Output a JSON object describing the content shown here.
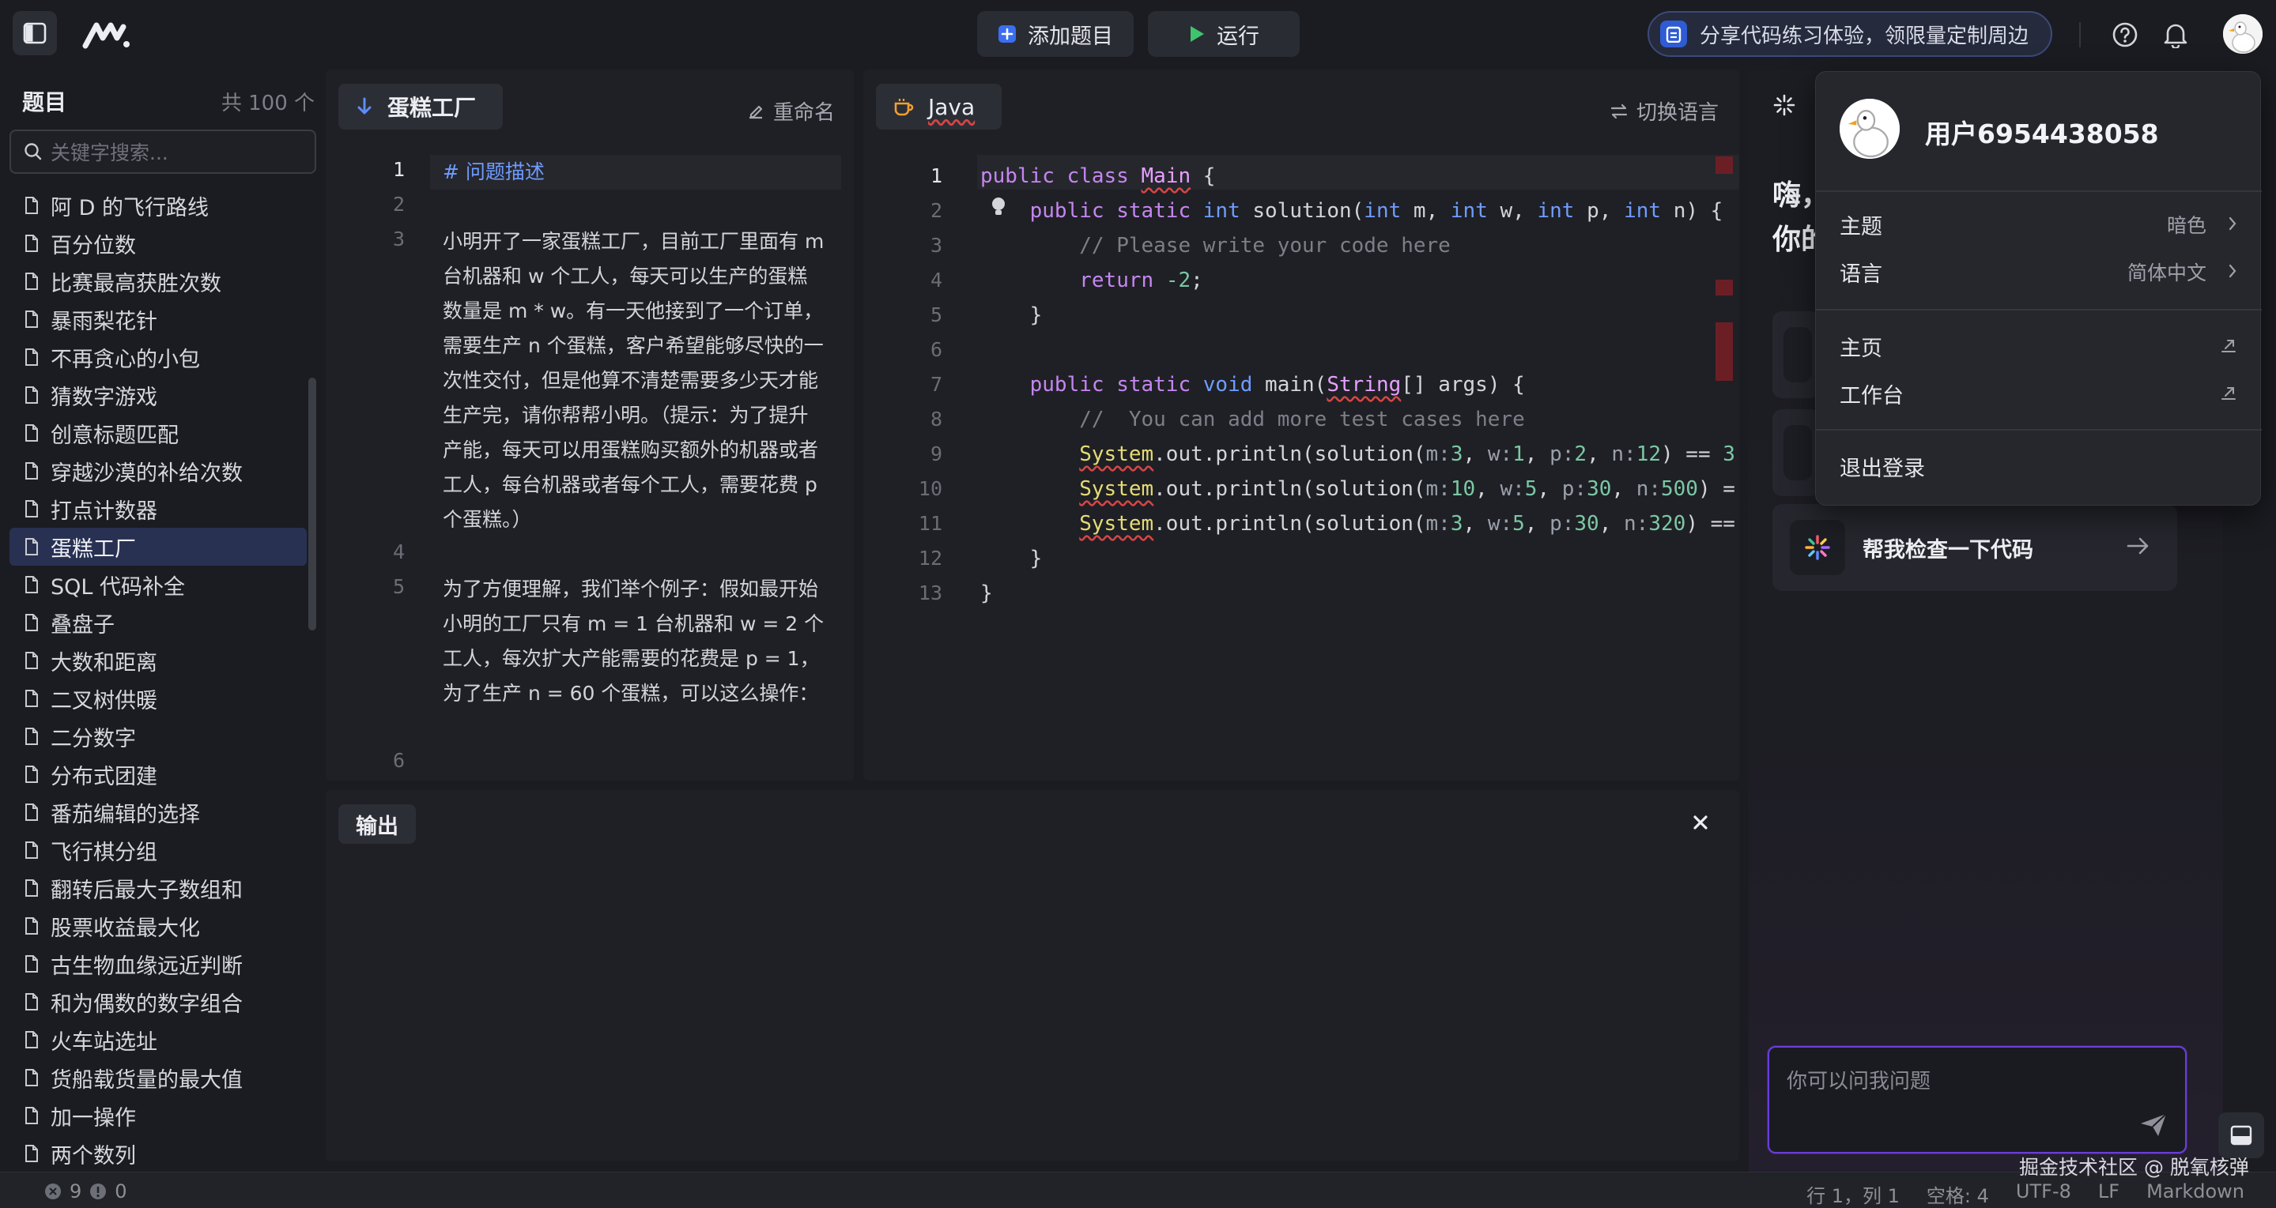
{
  "toolbar": {
    "add_question": "添加题目",
    "run": "运行",
    "promo": "分享代码练习体验，领限量定制周边"
  },
  "sidebar": {
    "title": "题目",
    "count": "共 100 个",
    "search_placeholder": "关键字搜索...",
    "items": [
      {
        "label": "阿 D 的飞行路线"
      },
      {
        "label": "百分位数"
      },
      {
        "label": "比赛最高获胜次数"
      },
      {
        "label": "暴雨梨花针"
      },
      {
        "label": "不再贪心的小包"
      },
      {
        "label": "猜数字游戏"
      },
      {
        "label": "创意标题匹配"
      },
      {
        "label": "穿越沙漠的补给次数"
      },
      {
        "label": "打点计数器"
      },
      {
        "label": "蛋糕工厂"
      },
      {
        "label": "SQL 代码补全"
      },
      {
        "label": "叠盘子"
      },
      {
        "label": "大数和距离"
      },
      {
        "label": "二叉树供暖"
      },
      {
        "label": "二分数字"
      },
      {
        "label": "分布式团建"
      },
      {
        "label": "番茄编辑的选择"
      },
      {
        "label": "飞行棋分组"
      },
      {
        "label": "翻转后最大子数组和"
      },
      {
        "label": "股票收益最大化"
      },
      {
        "label": "古生物血缘远近判断"
      },
      {
        "label": "和为偶数的数字组合"
      },
      {
        "label": "火车站选址"
      },
      {
        "label": "货船载货量的最大值"
      },
      {
        "label": "加一操作"
      },
      {
        "label": "两个数列"
      }
    ],
    "active_index": 9
  },
  "problem": {
    "tab": "蛋糕工厂",
    "rename": "重命名",
    "line_numbers": [
      "1",
      "2",
      "3",
      "4",
      "5",
      "6"
    ],
    "heading": "# 问题描述",
    "para1": "小明开了一家蛋糕工厂，目前工厂里面有 m 台机器和 w 个工人，每天可以生产的蛋糕数量是 m * w。有一天他接到了一个订单，需要生产 n 个蛋糕，客户希望能够尽快的一次性交付，但是他算不清楚需要多少天才能生产完，请你帮帮小明。（提示：为了提升产能，每天可以用蛋糕购买额外的机器或者工人，每台机器或者每个工人，需要花费 p 个蛋糕。）",
    "para2": "为了方便理解，我们举个例子：假如最开始小明的工厂只有 m = 1 台机器和 w = 2 个工人，每次扩大产能需要的花费是 p = 1，为了生产 n = 60 个蛋糕，可以这么操作："
  },
  "editor": {
    "language": "Java",
    "switch_language": "切换语言",
    "line_numbers": [
      "1",
      "2",
      "3",
      "4",
      "5",
      "6",
      "7",
      "8",
      "9",
      "10",
      "11",
      "12",
      "13"
    ]
  },
  "output": {
    "tab": "输出"
  },
  "ai": {
    "greeting_line1": "嗨，",
    "greeting_line2": "你的",
    "card_check": "帮我检查一下代码",
    "input_placeholder": "你可以问我问题"
  },
  "user_menu": {
    "name": "用户6954438058",
    "theme_label": "主题",
    "theme_value": "暗色",
    "language_label": "语言",
    "language_value": "简体中文",
    "home": "主页",
    "workspace": "工作台",
    "logout": "退出登录"
  },
  "statusbar": {
    "errors": "9",
    "warnings": "0",
    "position": "行 1，列 1",
    "spaces": "空格: 4",
    "encoding": "UTF-8",
    "eol": "LF",
    "mode": "Markdown"
  },
  "watermark": "掘金技术社区 @ 脱氧核弹",
  "colors": {
    "accent": "#2f5bd3",
    "active_item": "#283152",
    "input_border": "#6a3dd9",
    "error": "#d64545"
  }
}
